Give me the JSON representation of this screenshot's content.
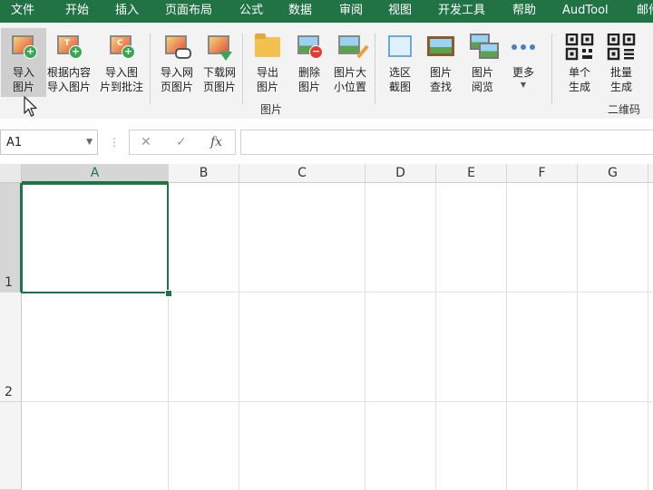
{
  "menu": [
    "文件",
    "开始",
    "插入",
    "页面布局",
    "公式",
    "数据",
    "审阅",
    "视图",
    "开发工具",
    "帮助",
    "AudTool",
    "邮件"
  ],
  "ribbon": {
    "buttons": [
      {
        "label": "导入\n图片",
        "icon": "image-import-icon"
      },
      {
        "label": "根据内容\n导入图片",
        "icon": "image-import-by-content-icon"
      },
      {
        "label": "导入图\n片到批注",
        "icon": "image-to-comment-icon"
      },
      {
        "label": "导入网\n页图片",
        "icon": "web-image-import-icon"
      },
      {
        "label": "下载网\n页图片",
        "icon": "web-image-download-icon"
      },
      {
        "label": "导出\n图片",
        "icon": "folder-export-icon"
      },
      {
        "label": "删除\n图片",
        "icon": "image-delete-icon"
      },
      {
        "label": "图片大\n小位置",
        "icon": "image-resize-icon"
      },
      {
        "label": "选区\n截图",
        "icon": "screenshot-icon"
      },
      {
        "label": "图片\n查找",
        "icon": "image-search-icon"
      },
      {
        "label": "图片\n阅览",
        "icon": "image-gallery-icon"
      },
      {
        "label": "更多",
        "icon": "more-dots-icon"
      },
      {
        "label": "单个\n生成",
        "icon": "qr-single-icon"
      },
      {
        "label": "批量\n生成",
        "icon": "qr-batch-icon"
      }
    ],
    "group_image": "图片",
    "group_qr": "二维码"
  },
  "formula": {
    "name_box": "A1",
    "cancel": "✕",
    "confirm": "✓",
    "fx": "fx",
    "value": ""
  },
  "grid": {
    "columns": [
      "A",
      "B",
      "C",
      "D",
      "E",
      "F",
      "G"
    ],
    "rows": [
      "1",
      "2"
    ],
    "selected_cell": "A1"
  },
  "colors": {
    "accent": "#217346"
  }
}
